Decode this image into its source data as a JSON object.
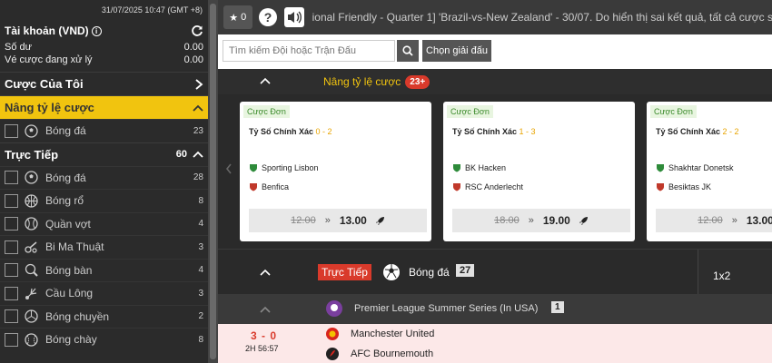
{
  "sidebar": {
    "datetime": "31/07/2025 10:47 (GMT +8)",
    "account_title": "Tài khoản (VND)",
    "balance_label": "Số dư",
    "balance_value": "0.00",
    "pending_label": "Vé cược đang xử lý",
    "pending_value": "0.00",
    "my_bets": "Cược Của Tôi",
    "boost_section": "Nâng tỷ lệ cược",
    "boost_items": [
      {
        "label": "Bóng đá",
        "count": "23",
        "icon": "soccer-ball-icon"
      }
    ],
    "live_section": "Trực Tiếp",
    "live_count": "60",
    "live_items": [
      {
        "label": "Bóng đá",
        "count": "28",
        "icon": "soccer-ball-icon"
      },
      {
        "label": "Bóng rổ",
        "count": "8",
        "icon": "basketball-icon"
      },
      {
        "label": "Quần vợt",
        "count": "4",
        "icon": "tennis-ball-icon"
      },
      {
        "label": "Bi Ma Thuật",
        "count": "3",
        "icon": "billiards-icon"
      },
      {
        "label": "Bóng bàn",
        "count": "4",
        "icon": "table-tennis-icon"
      },
      {
        "label": "Cầu Lông",
        "count": "3",
        "icon": "badminton-icon"
      },
      {
        "label": "Bóng chuyền",
        "count": "2",
        "icon": "volleyball-icon"
      },
      {
        "label": "Bóng chày",
        "count": "8",
        "icon": "baseball-icon"
      }
    ]
  },
  "topbar": {
    "star_count": "0",
    "ticker": "ional Friendly - Quarter 1] 'Brazil-vs-New Zealand' - 30/07. Do hiển thị sai kết quả, tất cả cược sẽ được"
  },
  "search": {
    "placeholder": "Tìm kiếm Đội hoặc Trận Đấu",
    "league_button": "Chọn giải đấu"
  },
  "boost": {
    "title": "Nâng tỷ lệ cược",
    "badge": "23+",
    "cards": [
      {
        "tag": "Cược Đơn",
        "market": "Tỷ Số Chính Xác",
        "score": "0 - 2",
        "home": "Sporting Lisbon",
        "away": "Benfica",
        "old_odds": "12.00",
        "new_odds": "13.00"
      },
      {
        "tag": "Cược Đơn",
        "market": "Tỷ Số Chính Xác",
        "score": "1 - 3",
        "home": "BK Hacken",
        "away": "RSC Anderlecht",
        "old_odds": "18.00",
        "new_odds": "19.00"
      },
      {
        "tag": "Cược Đơn",
        "market": "Tỷ Số Chính Xác",
        "score": "2 - 2",
        "home": "Shakhtar Donetsk",
        "away": "Besiktas JK",
        "old_odds": "12.00",
        "new_odds": "13.00"
      }
    ]
  },
  "live": {
    "tag": "Trực Tiếp",
    "sport": "Bóng đá",
    "count": "27",
    "col_header": "1x2"
  },
  "league": {
    "name": "Premier League Summer Series (In USA)",
    "count": "1"
  },
  "match": {
    "score": "3 - 0",
    "time": "2H 56:57",
    "home": "Manchester United",
    "away": "AFC Bournemouth"
  },
  "colors": {
    "accent_yellow": "#f1c40f",
    "live_red": "#d93a2b"
  }
}
